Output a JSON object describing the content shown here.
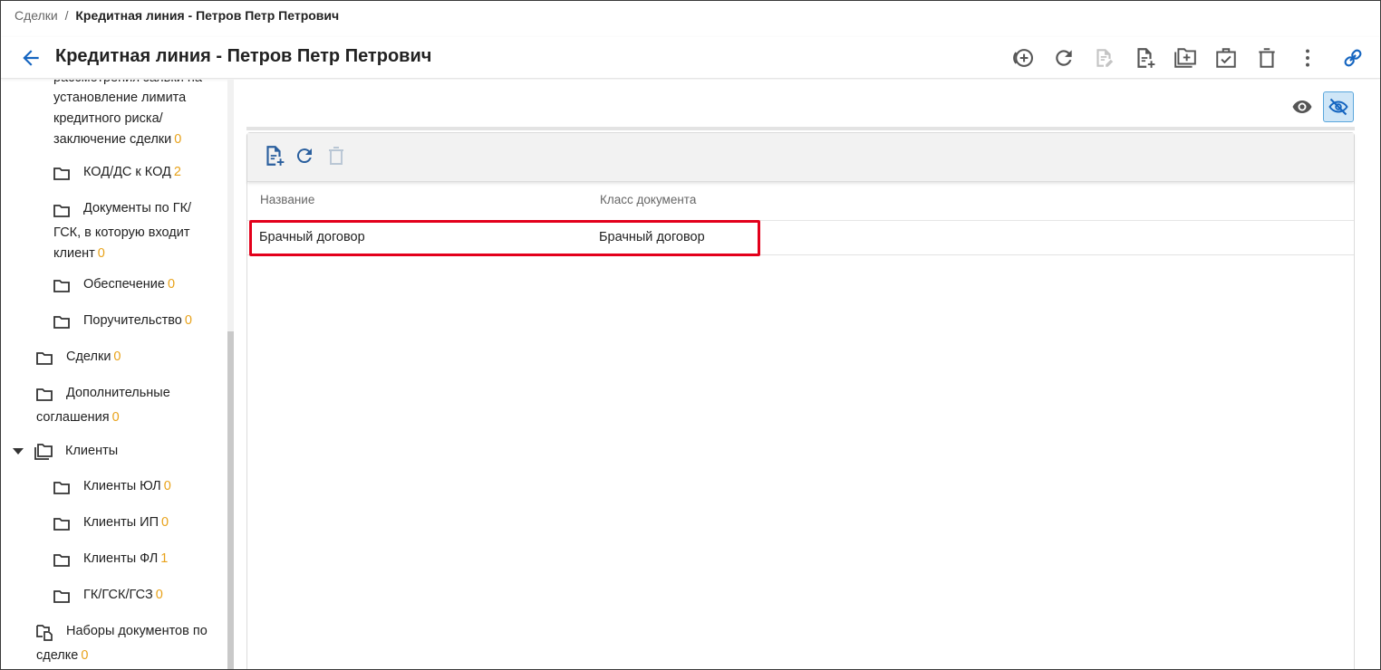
{
  "breadcrumb": {
    "root": "Сделки",
    "separator": "/",
    "current": "Кредитная линия - Петров Петр Петрович"
  },
  "header": {
    "title": "Кредитная линия - Петров Петр Петрович"
  },
  "icons": {
    "back": "arrow-left-icon",
    "toolbar": [
      "add-circle-icon",
      "refresh-icon",
      "edit-document-icon",
      "add-document-icon",
      "add-folder-icon",
      "clipboard-check-icon",
      "delete-icon",
      "more-vert-icon",
      "link-icon"
    ]
  },
  "colors": {
    "accent": "#1565c0",
    "count": "#e8a21a",
    "highlight": "#e3001b"
  },
  "sidebar": {
    "partial_item": {
      "line1": "рассмотрения заявки на",
      "line2": "установление лимита",
      "line3": "кредитного риска/",
      "line4": "заключение сделки",
      "count": "0"
    },
    "kod": {
      "label": "КОД/ДС к КОД",
      "count": "2"
    },
    "docs_gk": {
      "line1": "Документы по ГК/",
      "line2": "ГСК, в которую входит",
      "line3": "клиент",
      "count": "0"
    },
    "collateral": {
      "label": "Обеспечение",
      "count": "0"
    },
    "guarantee": {
      "label": "Поручительство",
      "count": "0"
    },
    "deals": {
      "label": "Сделки",
      "count": "0"
    },
    "additional": {
      "line1": "Дополнительные",
      "line2": "соглашения",
      "count": "0"
    },
    "clients": {
      "label": "Клиенты"
    },
    "clients_ul": {
      "label": "Клиенты ЮЛ",
      "count": "0"
    },
    "clients_ip": {
      "label": "Клиенты ИП",
      "count": "0"
    },
    "clients_fl": {
      "label": "Клиенты ФЛ",
      "count": "1"
    },
    "gk": {
      "label": "ГК/ГСК/ГСЗ",
      "count": "0"
    },
    "doc_sets": {
      "line1": "Наборы документов по",
      "line2": "сделке",
      "count": "0"
    }
  },
  "table": {
    "columns": [
      "Название",
      "Класс документа"
    ],
    "rows": [
      {
        "name": "Брачный договор",
        "class": "Брачный договор"
      }
    ]
  }
}
